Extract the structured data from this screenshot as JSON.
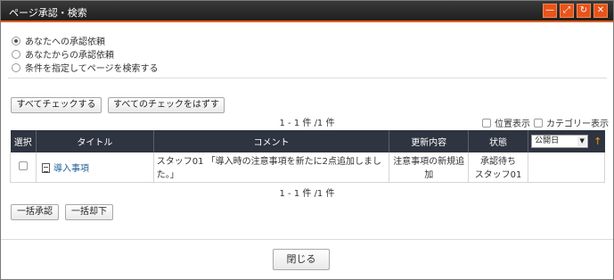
{
  "window": {
    "title": "ページ承認・検索",
    "controls": [
      "minimize-icon",
      "maximize-icon",
      "refresh-icon",
      "close-icon"
    ]
  },
  "search_mode": {
    "options": [
      {
        "label": "あなたへの承認依頼",
        "selected": true
      },
      {
        "label": "あなたからの承認依頼",
        "selected": false
      },
      {
        "label": "条件を指定してページを検索する",
        "selected": false
      }
    ]
  },
  "actions": {
    "check_all": "すべてチェックする",
    "uncheck_all": "すべてのチェックをはずす"
  },
  "pager": {
    "top": "1 - 1 件 /1 件",
    "bottom": "1 - 1 件 /1 件"
  },
  "display_options": {
    "position": "位置表示",
    "category": "カテゴリー表示"
  },
  "table": {
    "headers": {
      "select": "選択",
      "title": "タイトル",
      "comment": "コメント",
      "update": "更新内容",
      "status": "状態"
    },
    "sort": {
      "selected": "公開日",
      "direction_icon": "arrow-up-icon"
    },
    "rows": [
      {
        "title": "導入事項",
        "comment": "スタッフ01 「導入時の注意事項を新たに2点追加しました。」",
        "update": "注意事項の新規追加",
        "status_line1": "承認待ち",
        "status_line2": "スタッフ01"
      }
    ]
  },
  "bulk": {
    "approve": "一括承認",
    "reject": "一括却下"
  },
  "footer": {
    "close": "閉じる"
  },
  "colors": {
    "accent": "#e8541a",
    "header_bg": "#2f3441",
    "link": "#1e5e94"
  }
}
